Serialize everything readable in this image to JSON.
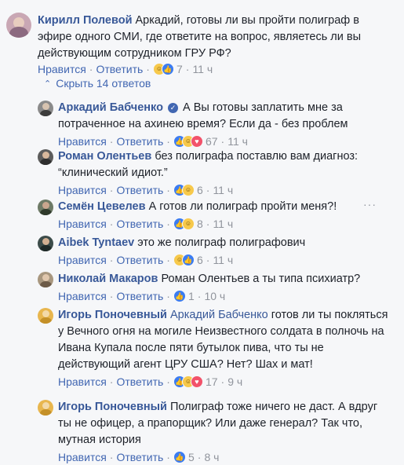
{
  "colors": {
    "link": "#385898",
    "action": "#4267b2",
    "muted": "#90949c",
    "like": "#3b7cf2",
    "love": "#f2526a",
    "haha": "#f7c94b"
  },
  "actions": {
    "like": "Нравится",
    "reply": "Ответить"
  },
  "hide_replies": "Скрыть 14 ответов",
  "top_comment": {
    "author": "Кирилл Полевой",
    "text": "Аркадий, готовы ли вы пройти полиграф в эфире одного СМИ, где ответите на вопрос, являетесь ли вы действующим сотрудником ГРУ РФ?",
    "reactions": [
      "haha",
      "like"
    ],
    "count": "7",
    "time": "11 ч"
  },
  "replies": [
    {
      "author": "Аркадий Бабченко",
      "verified": true,
      "text": "А Вы готовы заплатить мне за потраченное на ахинею время? Если да - без проблем",
      "reactions": [
        "like",
        "haha",
        "love"
      ],
      "count": "67",
      "time": "11 ч"
    },
    {
      "author": "Роман Олентьев",
      "text": "без полиграфа поставлю вам диагноз: “клинический идиот.”",
      "reactions": [
        "like",
        "haha"
      ],
      "count": "6",
      "time": "11 ч"
    },
    {
      "author": "Семён Цевелев",
      "text": "А готов ли полиграф пройти меня?!",
      "reactions": [
        "like",
        "haha"
      ],
      "count": "8",
      "time": "11 ч"
    },
    {
      "author": "Aibek Tyntaev",
      "text": "это же полиграф полиграфович",
      "reactions": [
        "haha",
        "like"
      ],
      "count": "6",
      "time": "11 ч"
    },
    {
      "author": "Николай Макаров",
      "text": "Роман Олентьев а ты типа психиатр?",
      "reactions": [
        "like"
      ],
      "count": "1",
      "time": "10 ч"
    },
    {
      "author": "Игорь Поночевный",
      "mention": "Аркадий Бабченко",
      "text": "готов ли ты покляться у Вечного огня на могиле Неизвестного солдата в полночь на Ивана Купала после пяти бутылок пива, что ты не действующий агент ЦРУ США? Нет? Шах и мат!",
      "reactions": [
        "like",
        "haha",
        "love"
      ],
      "count": "17",
      "time": "9 ч"
    },
    {
      "author": "Игорь Поночевный",
      "text": "Полиграф тоже ничего не даст. А вдруг ты не офицер, а прапорщик? Или даже генерал? Так что, мутная история",
      "reactions": [
        "like"
      ],
      "count": "5",
      "time": "8 ч"
    }
  ]
}
